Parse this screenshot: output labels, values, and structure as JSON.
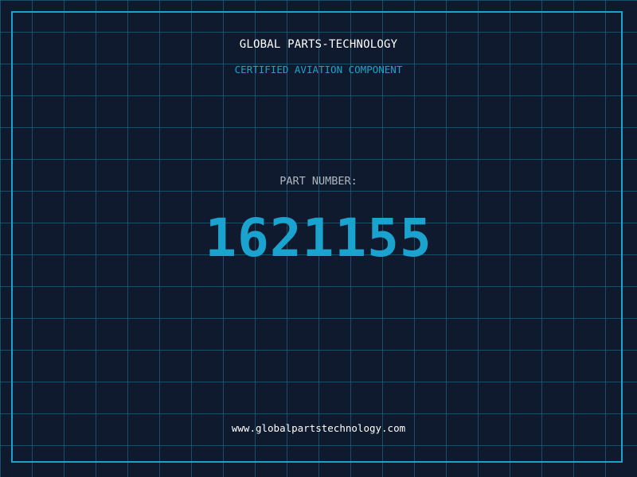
{
  "header": {
    "brand": "GLOBAL PARTS-TECHNOLOGY",
    "subtitle": "CERTIFIED AVIATION COMPONENT"
  },
  "part": {
    "label": "PART NUMBER:",
    "number": "1621155"
  },
  "footer": {
    "website": "www.globalpartstechnology.com"
  },
  "colors": {
    "background": "#101a2e",
    "grid": "#1e7896",
    "accent": "#1ba3cf",
    "label": "#aeb6c2",
    "text": "#ffffff"
  }
}
